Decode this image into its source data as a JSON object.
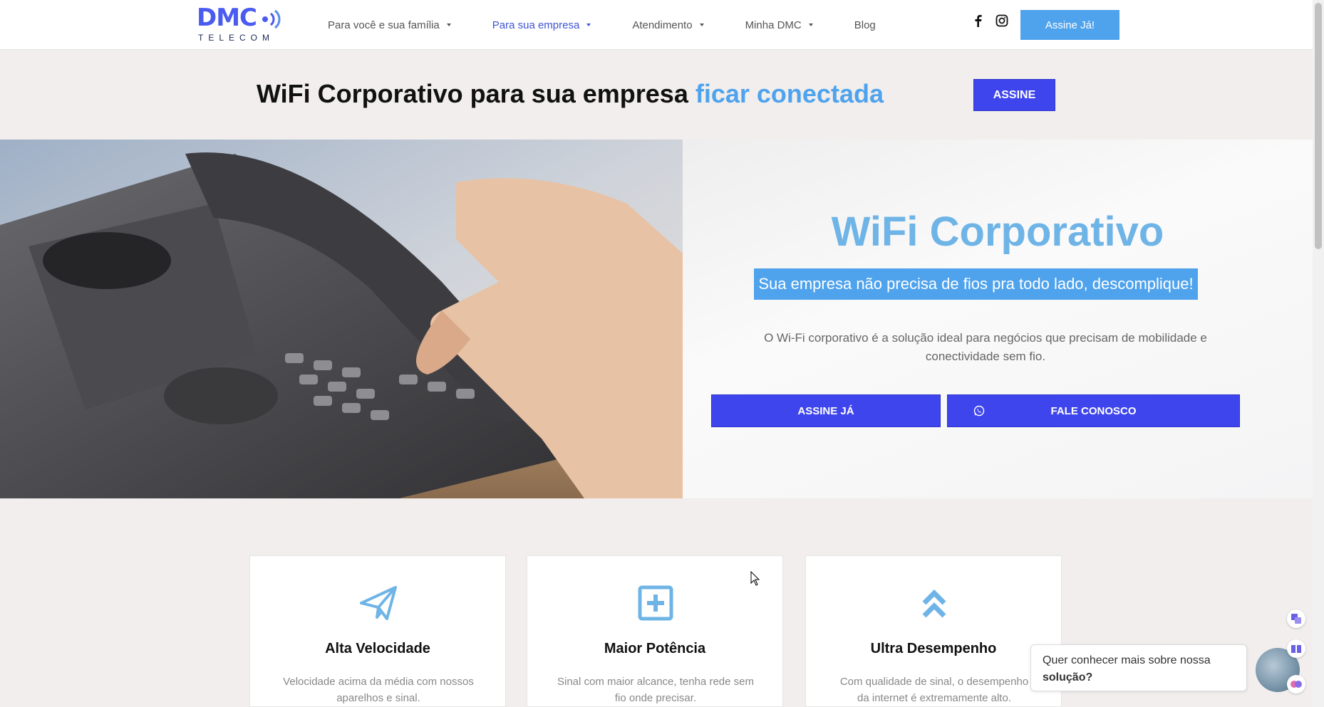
{
  "logo": {
    "word": "DMC",
    "sub": "TELECOM"
  },
  "nav": {
    "items": [
      {
        "label": "Para você e sua família",
        "dropdown": true
      },
      {
        "label": "Para sua empresa",
        "dropdown": true,
        "active": true
      },
      {
        "label": "Atendimento",
        "dropdown": true
      },
      {
        "label": "Minha DMC",
        "dropdown": true
      },
      {
        "label": "Blog",
        "dropdown": false
      }
    ],
    "social": [
      "facebook-icon",
      "instagram-icon"
    ],
    "cta_label": "Assine Já!"
  },
  "banner": {
    "title": "WiFi Corporativo para sua empresa ",
    "title_highlight": "ficar conectada",
    "button_label": "ASSINE"
  },
  "hero": {
    "title": "WiFi Corporativo",
    "subtitle": "Sua empresa não precisa de fios pra todo lado, descomplique!",
    "description": "O Wi-Fi corporativo é a solução ideal para negócios que precisam de mobilidade e conectividade sem fio.",
    "button_primary": "ASSINE JÁ",
    "button_secondary": "FALE CONOSCO"
  },
  "features": [
    {
      "icon": "paper-plane-icon",
      "title": "Alta Velocidade",
      "description": "Velocidade acima da média com nossos aparelhos e sinal."
    },
    {
      "icon": "plus-square-icon",
      "title": "Maior Potência",
      "description": "Sinal com maior alcance, tenha rede sem fio onde precisar."
    },
    {
      "icon": "double-chevron-up-icon",
      "title": "Ultra Desempenho",
      "description": "Com qualidade de sinal, o desempenho da internet é extremamente alto."
    }
  ],
  "chat": {
    "text": "Quer conhecer mais sobre nossa ",
    "text_bold": "solução?"
  },
  "colors": {
    "brand_blue": "#4fa3ed",
    "button_blue": "#3f45ec",
    "title_light_blue": "#6fb4e6"
  }
}
